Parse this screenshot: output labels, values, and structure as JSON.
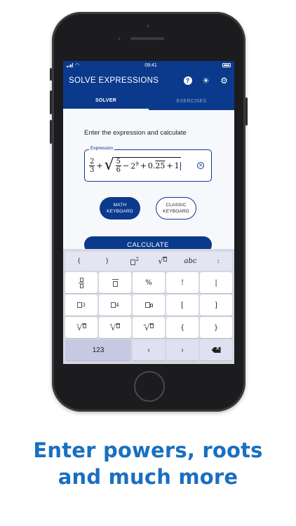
{
  "status_bar": {
    "time": "09:41"
  },
  "app_bar": {
    "title": "SOLVE EXPRESSIONS",
    "icons": [
      "help-icon",
      "brightness-icon",
      "gear-icon"
    ]
  },
  "tabs": [
    {
      "label": "SOLVER",
      "active": true
    },
    {
      "label": "EXERCISES",
      "active": false
    }
  ],
  "solver": {
    "prompt": "Enter the expression and calculate",
    "expression_label": "Expression",
    "expression": {
      "frac1_num": "2",
      "frac1_den": "3",
      "plus1": "+",
      "sqrt_frac_num": "5",
      "sqrt_frac_den": "6",
      "minus": "−",
      "power_base": "2",
      "power_exp": "9",
      "plus2": "+",
      "decimal_prefix": "0.",
      "decimal_repeat": "25",
      "plus3": "+",
      "last": "1"
    },
    "keyboard_toggle": {
      "math": "MATH KEYBOARD",
      "classic": "CLASSIC KEYBOARD",
      "selected": "math"
    },
    "calculate_label": "CALCULATE"
  },
  "keyboard": {
    "function_row": [
      "(",
      ")",
      "□²",
      "√□",
      "abc",
      ":"
    ],
    "keys_row1": [
      "fraction",
      "overline",
      "%",
      "!",
      "|"
    ],
    "keys_row2": [
      "□³",
      "□⁴",
      "□^□",
      "[",
      "]"
    ],
    "keys_row3": [
      "∛□",
      "∜□",
      "ⁿ√□",
      "{",
      "}"
    ],
    "percent": "%",
    "factorial": "!",
    "pipe": "|",
    "lbracket": "[",
    "rbracket": "]",
    "lbrace": "{",
    "rbrace": "}",
    "lparen": "(",
    "rparen": ")",
    "abc": "abc",
    "colon": ":",
    "num_toggle": "123",
    "cube": "3",
    "fourth": "4",
    "idx3": "3",
    "idx4": "4",
    "idxn": "n"
  },
  "headline": {
    "line1": "Enter powers, roots",
    "line2": "and much more"
  },
  "colors": {
    "primary": "#0b3a8c",
    "headline": "#1a6fc0",
    "background": "#f7f8fc"
  }
}
